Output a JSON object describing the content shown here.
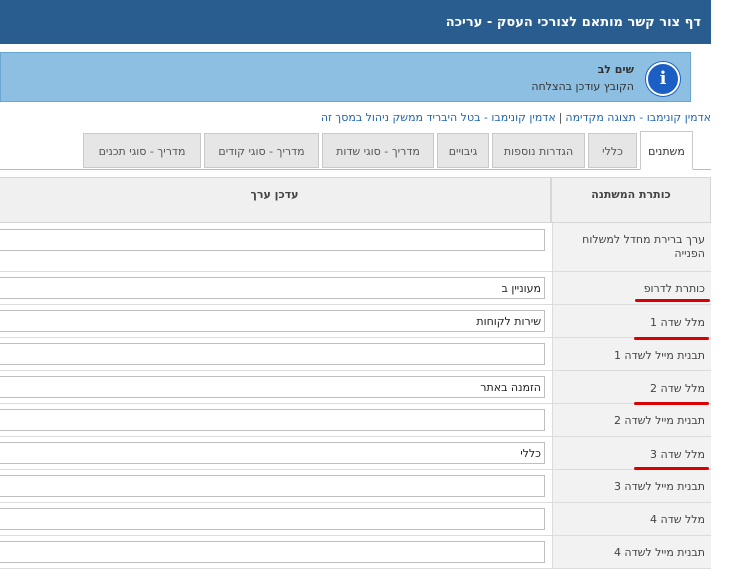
{
  "header": {
    "title": "דף צור קשר מותאם לצורכי העסק - עריכה"
  },
  "notice": {
    "icon": "info-icon",
    "title": "שים לב",
    "message": "הקובץ עודכן בהצלחה"
  },
  "breadcrumb": {
    "items": [
      "אדמין קונימבו - תצוגה מקדימה",
      "אדמין קונימבו - בטל היבריד ממשק ניהול במסך זה"
    ],
    "separator": "|"
  },
  "tabs": [
    {
      "label": "משתנים",
      "active": true
    },
    {
      "label": "כללי"
    },
    {
      "label": "הגדרות נוספות"
    },
    {
      "label": "גיבויים"
    },
    {
      "label": "מדריך - סוגי שדות"
    },
    {
      "label": "מדריך - סוגי קודים"
    },
    {
      "label": "מדריך - סוגי תכנים"
    }
  ],
  "table": {
    "col_title": "כותרת המשתנה",
    "col_value": "עדכן ערך",
    "rows": [
      {
        "label": "ערך ברירת מחדל למשלוח הפנייה",
        "value": ""
      },
      {
        "label": "כותרת לדרופ",
        "value": "מעוניין ב"
      },
      {
        "label": "מלל שדה 1",
        "value": "שירות לקוחות"
      },
      {
        "label": "תבנית מייל לשדה 1",
        "value": ""
      },
      {
        "label": "מלל שדה 2",
        "value": "הזמנה באתר"
      },
      {
        "label": "תבנית מייל לשדה 2",
        "value": ""
      },
      {
        "label": "מלל שדה 3",
        "value": "כללי"
      },
      {
        "label": "תבנית מייל לשדה 3",
        "value": ""
      },
      {
        "label": "מלל שדה 4",
        "value": ""
      },
      {
        "label": "תבנית מייל לשדה 4",
        "value": ""
      }
    ]
  },
  "colors": {
    "header_bg": "#2a5d8f",
    "notice_bg": "#8dbfe2",
    "highlight": "#d80000"
  }
}
